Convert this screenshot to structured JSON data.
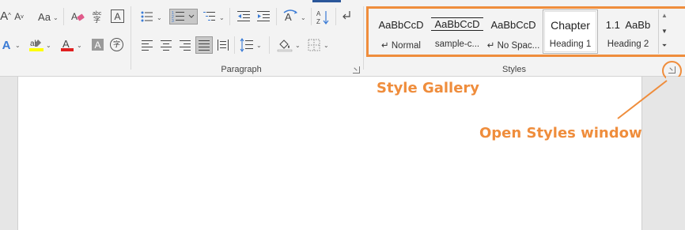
{
  "ribbon": {
    "font_group": {
      "buttons": {
        "grow_font": "A",
        "shrink_font": "A",
        "change_case": "Aa",
        "text_effects": "A",
        "highlight": "ab",
        "font_color": "A",
        "char_shading": "A",
        "enclose": "字"
      }
    },
    "paragraph_group": {
      "label": "Paragraph"
    },
    "styles_group": {
      "label": "Styles",
      "items": [
        {
          "preview": "AaBbCcD",
          "name": "↵ Normal"
        },
        {
          "preview": "AaBbCcD",
          "name": "sample-c..."
        },
        {
          "preview": "AaBbCcD",
          "name": "↵ No Spac..."
        },
        {
          "preview": "Chapter",
          "name": "Heading 1"
        },
        {
          "preview": "1.1  AaBb",
          "name": "Heading 2"
        }
      ]
    }
  },
  "annotations": {
    "style_gallery": "Style Gallery",
    "open_styles": "Open Styles window"
  },
  "colors": {
    "accent": "#ef8d3c",
    "highlight_yellow": "#ffff00",
    "font_red": "#e02020",
    "selected_tile_border": "#b5b5b5"
  }
}
